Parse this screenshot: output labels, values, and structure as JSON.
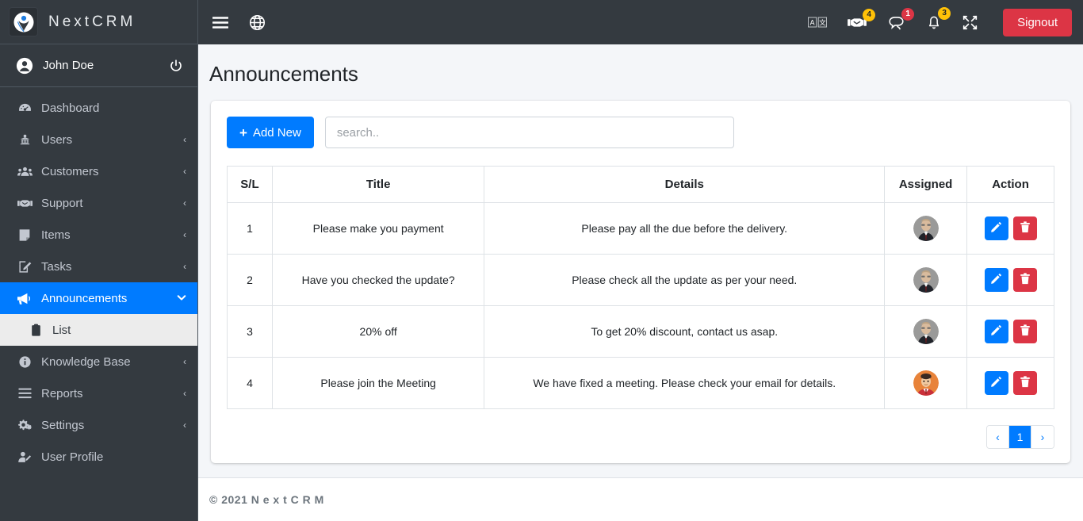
{
  "brand": {
    "name": "NextCRM",
    "logo_icon": "nextcrm-logo-icon"
  },
  "sidebar": {
    "user": {
      "name": "John Doe",
      "avatar_icon": "user-circle-icon",
      "power_icon": "power-off-icon"
    },
    "items": [
      {
        "label": "Dashboard",
        "icon": "tachometer-icon",
        "arrow": "",
        "active": false
      },
      {
        "label": "Users",
        "icon": "users-cog-icon",
        "arrow": "‹",
        "active": false
      },
      {
        "label": "Customers",
        "icon": "user-group-icon",
        "arrow": "‹",
        "active": false
      },
      {
        "label": "Support",
        "icon": "handshake-icon",
        "arrow": "‹",
        "active": false
      },
      {
        "label": "Items",
        "icon": "note-icon",
        "arrow": "‹",
        "active": false
      },
      {
        "label": "Tasks",
        "icon": "edit-square-icon",
        "arrow": "‹",
        "active": false
      },
      {
        "label": "Announcements",
        "icon": "bullhorn-icon",
        "arrow": "∨",
        "active": true
      },
      {
        "label": "Knowledge Base",
        "icon": "info-circle-icon",
        "arrow": "‹",
        "active": false
      },
      {
        "label": "Reports",
        "icon": "bars-icon",
        "arrow": "‹",
        "active": false
      },
      {
        "label": "Settings",
        "icon": "cogs-icon",
        "arrow": "‹",
        "active": false
      },
      {
        "label": "User Profile",
        "icon": "user-edit-icon",
        "arrow": "",
        "active": false
      }
    ],
    "sub_item": {
      "label": "List",
      "icon": "clipboard-icon"
    }
  },
  "navbar": {
    "menu_icon": "hamburger-menu-icon",
    "globe_icon": "globe-icon",
    "language_icon": "language-translate-icon",
    "support_icon": "handshake-icon",
    "support_badge": "4",
    "messages_icon": "comments-icon",
    "messages_badge": "1",
    "notifications_icon": "bell-icon",
    "notifications_badge": "3",
    "fullscreen_icon": "expand-arrows-icon",
    "signout_label": "Signout"
  },
  "page": {
    "title": "Announcements"
  },
  "toolbar": {
    "add_label": "Add New",
    "add_plus": "+",
    "search_placeholder": "search..",
    "search_value": ""
  },
  "table": {
    "columns": [
      "S/L",
      "Title",
      "Details",
      "Assigned",
      "Action"
    ],
    "rows": [
      {
        "sl": "1",
        "title": "Please make you payment",
        "details": "Please pay all the due before the delivery.",
        "avatar": "photo-man-suit"
      },
      {
        "sl": "2",
        "title": "Have you checked the update?",
        "details": "Please check all the update as per your need.",
        "avatar": "photo-man-suit"
      },
      {
        "sl": "3",
        "title": "20% off",
        "details": "To get 20% discount, contact us asap.",
        "avatar": "photo-man-suit"
      },
      {
        "sl": "4",
        "title": "Please join the Meeting",
        "details": "We have fixed a meeting. Please check your email for details.",
        "avatar": "cartoon-avatar"
      }
    ],
    "edit_icon": "pencil-icon",
    "delete_icon": "trash-icon"
  },
  "pagination": {
    "prev": "‹",
    "pages": [
      "1"
    ],
    "next": "›",
    "current": "1"
  },
  "footer": {
    "copyright": "© 2021 N e x t C R M"
  },
  "colors": {
    "sidebar_bg": "#343a40",
    "accent_blue": "#007bff",
    "danger_red": "#dc3545",
    "warning_yellow": "#ffc107",
    "page_bg": "#f4f6f9",
    "submenu_bg": "#ececec"
  }
}
